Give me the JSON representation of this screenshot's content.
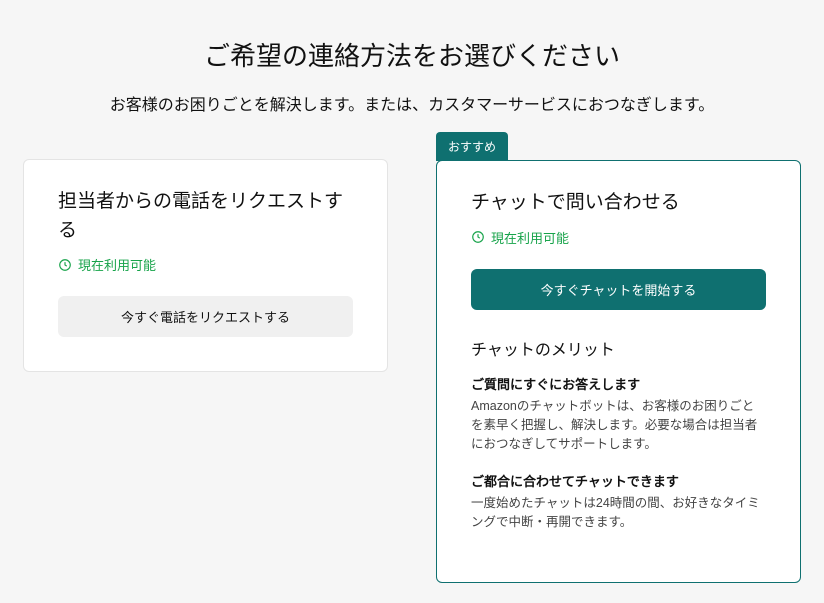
{
  "page": {
    "title": "ご希望の連絡方法をお選びください",
    "subtitle": "お客様のお困りごとを解決します。または、カスタマーサービスにおつなぎします。"
  },
  "phone_card": {
    "title": "担当者からの電話をリクエストする",
    "availability": "現在利用可能",
    "button": "今すぐ電話をリクエストする"
  },
  "chat_card": {
    "badge": "おすすめ",
    "title": "チャットで問い合わせる",
    "availability": "現在利用可能",
    "button": "今すぐチャットを開始する",
    "benefits_title": "チャットのメリット",
    "benefits": [
      {
        "heading": "ご質問にすぐにお答えします",
        "text": "Amazonのチャットボットは、お客様のお困りごとを素早く把握し、解決します。必要な場合は担当者におつなぎしてサポートします。"
      },
      {
        "heading": "ご都合に合わせてチャットできます",
        "text": "一度始めたチャットは24時間の間、お好きなタイミングで中断・再開できます。"
      }
    ]
  }
}
